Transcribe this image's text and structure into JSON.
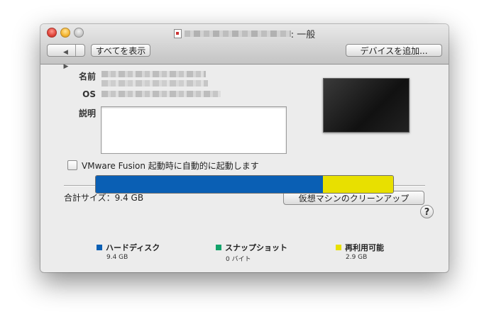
{
  "window": {
    "title_suffix": ": 一般"
  },
  "toolbar": {
    "back_glyph": "◀",
    "forward_glyph": "▶",
    "show_all_label": "すべてを表示",
    "add_device_label": "デバイスを追加..."
  },
  "info": {
    "name_label": "名前",
    "os_label": "OS",
    "description_label": "説明",
    "description_value": ""
  },
  "startup": {
    "checkbox_label": "VMware Fusion 起動時に自動的に起動します",
    "checked": false
  },
  "storage": {
    "total_label": "合計サイズ：9.4 GB",
    "cleanup_button_label": "仮想マシンのクリーンアップ",
    "legend": [
      {
        "name": "ハードディスク",
        "value": "9.4 GB",
        "color": "#0a5fb4",
        "fraction": 0.763
      },
      {
        "name": "スナップショット",
        "value": "0 バイト",
        "color": "#12a26a",
        "fraction": 0.0
      },
      {
        "name": "再利用可能",
        "value": "2.9 GB",
        "color": "#e8e000",
        "fraction": 0.237
      }
    ]
  },
  "help": {
    "label": "?"
  },
  "colors": {
    "accent_blue": "#0a5fb4",
    "accent_green": "#12a26a",
    "accent_yellow": "#e8e000"
  }
}
